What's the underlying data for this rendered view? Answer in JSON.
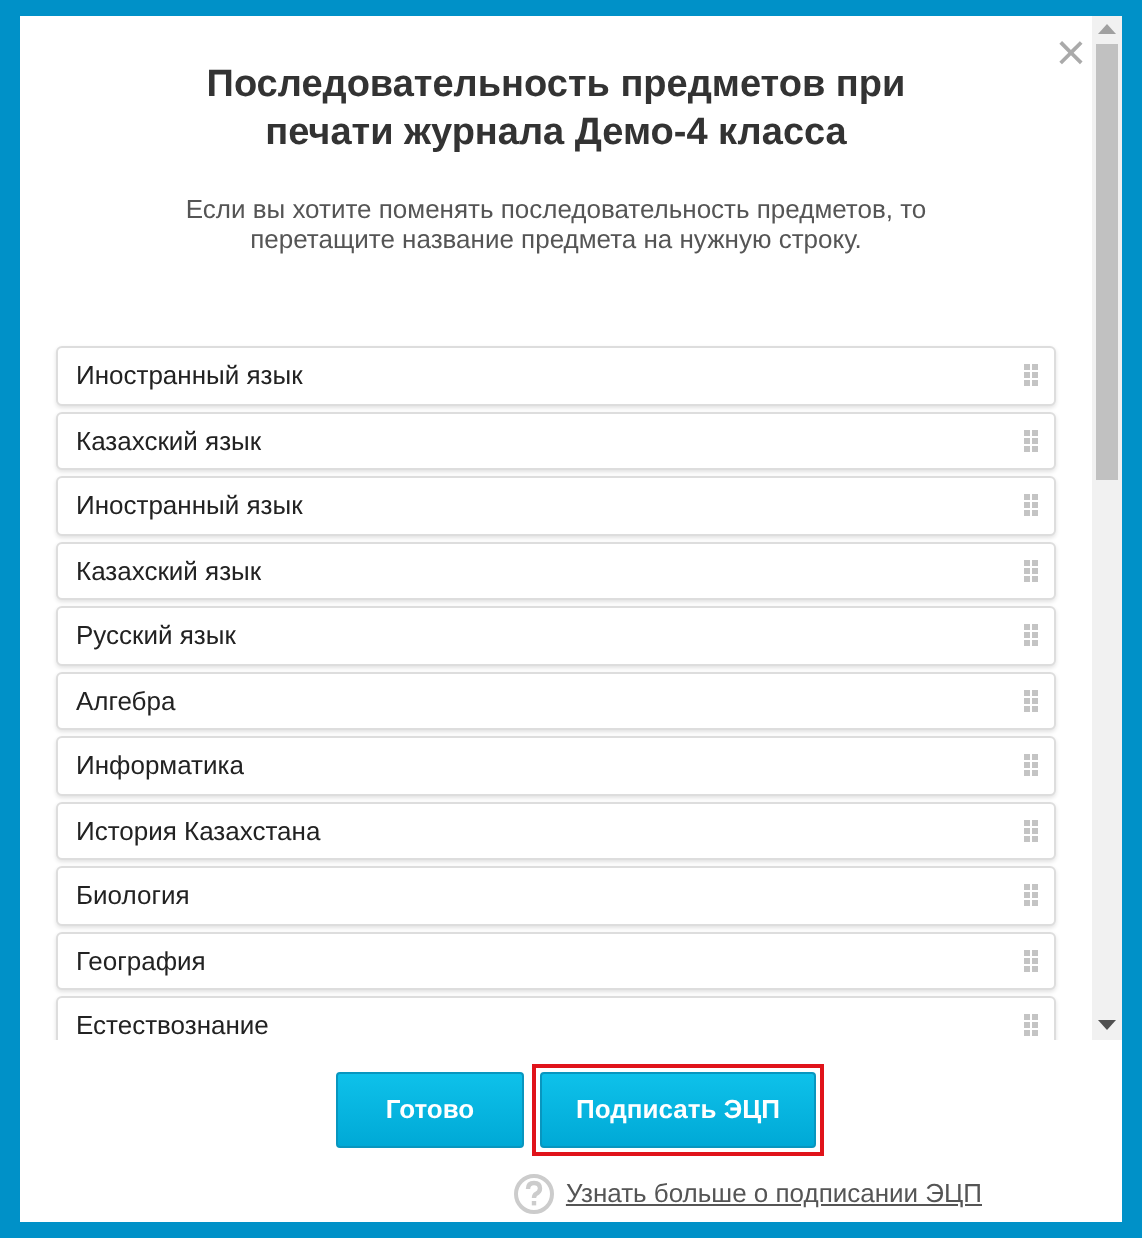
{
  "dialog": {
    "title": "Последовательность предметов при печати журнала Демо-4 класса",
    "description": "Если вы хотите поменять последовательность предметов, то перетащите название предмета на нужную строку.",
    "close": "×"
  },
  "subjects": [
    {
      "name": "Иностранный язык"
    },
    {
      "name": "Казахский язык"
    },
    {
      "name": "Иностранный язык"
    },
    {
      "name": "Казахский язык"
    },
    {
      "name": "Русский язык"
    },
    {
      "name": "Алгебра"
    },
    {
      "name": "Информатика"
    },
    {
      "name": "История Казахстана"
    },
    {
      "name": "Биология"
    },
    {
      "name": "География"
    },
    {
      "name": "Естествознание"
    }
  ],
  "buttons": [
    {
      "label": "Готово",
      "highlighted": false
    },
    {
      "label": "Подписать ЭЦП",
      "highlighted": true
    }
  ],
  "help_link": "Узнать больше о подписании ЭЦП"
}
